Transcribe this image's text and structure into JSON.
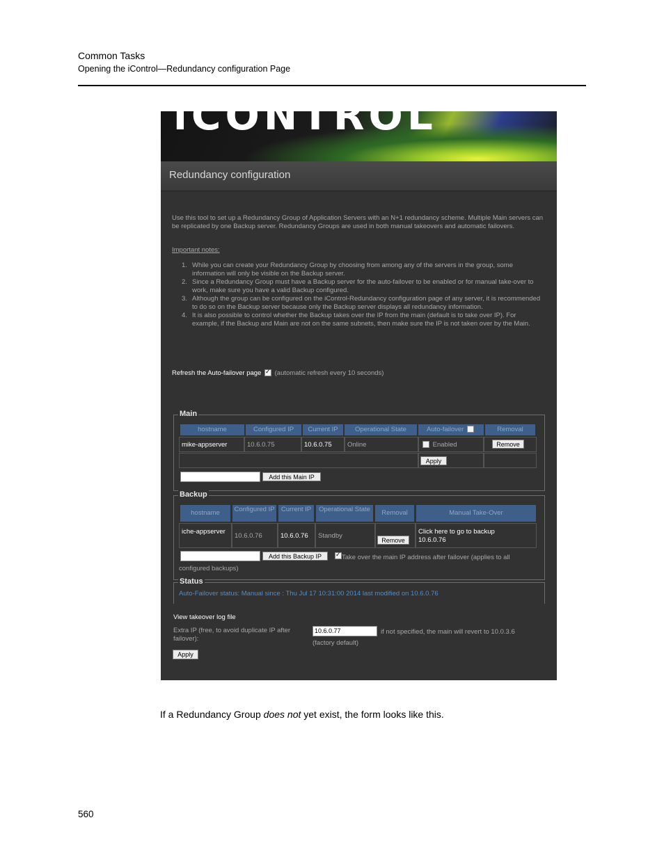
{
  "header": {
    "section": "Common Tasks",
    "subsection": "Opening the iControl—Redundancy configuration Page"
  },
  "caption": {
    "before": "If a Redundancy Group ",
    "emphasis": "does not",
    "after": " yet exist, the form looks like this."
  },
  "page_number": "560",
  "screenshot": {
    "banner_logo": "iCONTROL",
    "title": "Redundancy configuration",
    "intro": "Use this tool to set up a Redundancy Group of Application Servers with an N+1 redundancy scheme. Multiple Main servers can be replicated by one Backup server. Redundancy Groups are used in both manual takeovers and automatic failovers.",
    "notes_heading": "Important notes:",
    "notes": [
      {
        "num": "1.",
        "text": "While you can create your Redundancy Group by choosing from among any of the servers in the group, some information will only be visible on the Backup server."
      },
      {
        "num": "2.",
        "text": "Since a Redundancy Group must have a Backup server for the auto-failover to be enabled or for manual take-over to work, make sure you have a valid Backup configured."
      },
      {
        "num": "3.",
        "text": "Although the group can be configured on the iControl-Redundancy configuration page of any server, it is recommended to do so on the Backup server because only the Backup server displays all redundancy information."
      },
      {
        "num": "4.",
        "text": "It is also possible to control whether the Backup takes over the IP from the main (default is to take over IP). For example, if the Backup and Main are not on the same subnets, then make sure the IP is not taken over by the Main."
      }
    ],
    "refresh": {
      "label": "Refresh the Auto-failover page",
      "note": "(automatic refresh every 10 seconds)",
      "checked": true
    },
    "main": {
      "legend": "Main",
      "headers": [
        "hostname",
        "Configured IP",
        "Current IP",
        "Operational State",
        "Auto-failover",
        "Removal"
      ],
      "row": {
        "hostname": "mike-appserver",
        "configured_ip": "10.6.0.75",
        "current_ip": "10.6.0.75",
        "state": "Online",
        "enabled_label": "Enabled",
        "remove": "Remove"
      },
      "apply": "Apply",
      "add_button": "Add this Main IP",
      "add_value": ""
    },
    "backup": {
      "legend": "Backup",
      "headers": [
        "hostname",
        "Configured IP",
        "Current IP",
        "Operational State",
        "Removal",
        "Manual Take-Over"
      ],
      "row": {
        "hostname": "iche-appserver",
        "configured_ip": "10.6.0.76",
        "current_ip": "10.6.0.76",
        "state": "Standby",
        "remove": "Remove",
        "takeover_line1": "Click here to go to backup",
        "takeover_line2": "10.6.0.76"
      },
      "add_button": "Add this Backup IP",
      "add_value": "",
      "takeover_note": "Take over the main IP address after failover (applies to all configured backups)",
      "takeover_checked": true
    },
    "status": {
      "legend": "Status",
      "text": "Auto-Failover status: Manual since : Thu Jul 17 10:31:00 2014 last modified on 10.6.0.76"
    },
    "log_link": "View takeover log file",
    "extra_ip": {
      "label": "Extra IP (free, to avoid duplicate IP after failover):",
      "value": "10.6.0.77",
      "note": "if not specified, the main will revert to 10.0.3.6 (factory default)",
      "apply": "Apply"
    },
    "colors": {
      "panel": "#323232",
      "table_header": "#3e5f8a",
      "status_text": "#4a8fd2"
    }
  }
}
